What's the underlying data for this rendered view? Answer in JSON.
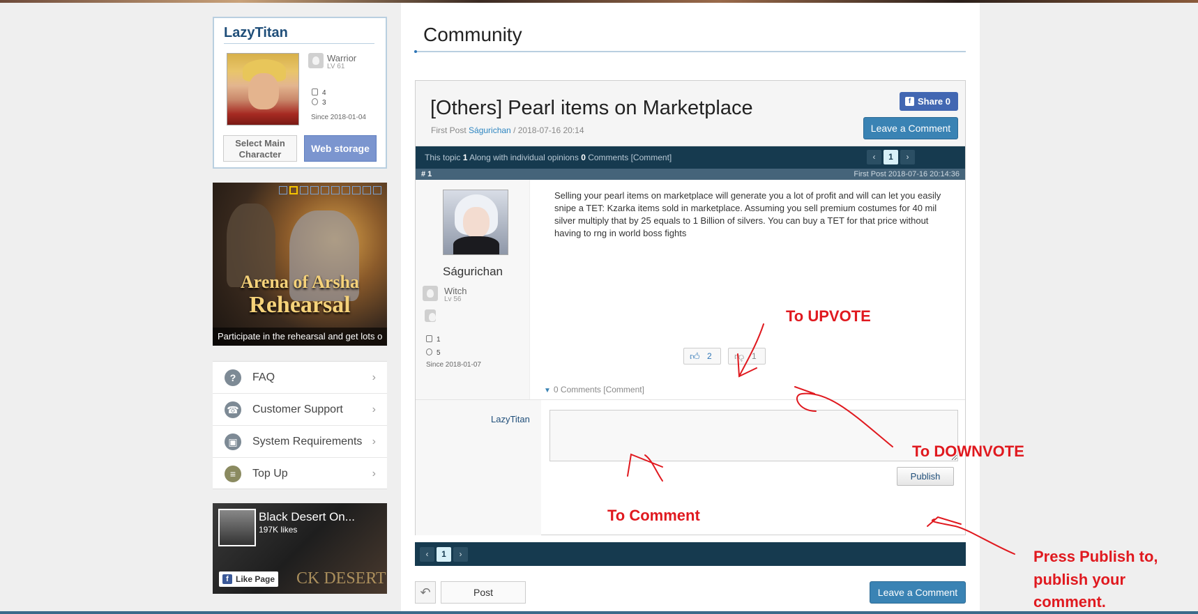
{
  "profile": {
    "name": "LazyTitan",
    "class_name": "Warrior",
    "class_level": "LV 61",
    "posts": "4",
    "comments": "3",
    "since": "Since 2018-01-04",
    "select_main_label": "Select Main Character",
    "web_storage_label": "Web storage"
  },
  "banner": {
    "title_line1": "Arena of Arsha",
    "title_line2": "Rehearsal",
    "caption": "Participate in the rehearsal and get lots o",
    "slide_count": 10,
    "active_slide": 2
  },
  "menu": {
    "items": [
      {
        "label": "FAQ",
        "icon": "question-icon"
      },
      {
        "label": "Customer Support",
        "icon": "headset-icon"
      },
      {
        "label": "System Requirements",
        "icon": "monitor-icon"
      },
      {
        "label": "Top Up",
        "icon": "coins-icon"
      }
    ]
  },
  "facebook": {
    "page_name": "Black Desert On...",
    "likes": "197K likes",
    "like_label": "Like Page",
    "brand_text": "CK DESERT"
  },
  "main": {
    "section_title": "Community",
    "post_title": "[Others] Pearl items on Marketplace",
    "first_post_label": "First Post",
    "author": "Ságurichan",
    "post_date": "/ 2018-07-16 20:14",
    "share_label": "Share 0",
    "leave_comment_label": "Leave a Comment",
    "topic_text_pre": "This topic",
    "topic_count": "1",
    "topic_text_mid": "Along with individual opinions",
    "comment_count": "0",
    "topic_text_post": "Comments [Comment]",
    "page_current": "1",
    "post_number": "# 1",
    "post_full_date": "First Post 2018-07-16 20:14:36",
    "author_class": "Witch",
    "author_level": "Lv 56",
    "author_posts": "1",
    "author_comments": "5",
    "author_since": "Since 2018-01-07",
    "body": "Selling your pearl items on marketplace will generate you a lot of profit and will can let you easily snipe a TET: Kzarka items sold in marketplace. Assuming you sell premium costumes for 40 mil silver multiply that by 25 equals to 1 Billion of silvers. You can buy a TET for that price without having to rng in world boss fights",
    "upvotes": "2",
    "downvotes": "1",
    "comments_toggle": "0 Comments [Comment]",
    "commenter": "LazyTitan",
    "comment_placeholder": "",
    "publish_label": "Publish",
    "post_button_label": "Post"
  },
  "annotations": {
    "upvote": "To UPVOTE",
    "downvote": "To DOWNVOTE",
    "comment": "To Comment",
    "publish_line1": "Press Publish to,",
    "publish_line2": "publish your",
    "publish_line3": "comment."
  },
  "colors": {
    "accent": "#3a83b4",
    "header_bar": "#163a4f",
    "annotation": "#e0191f",
    "facebook": "#4267b2"
  }
}
